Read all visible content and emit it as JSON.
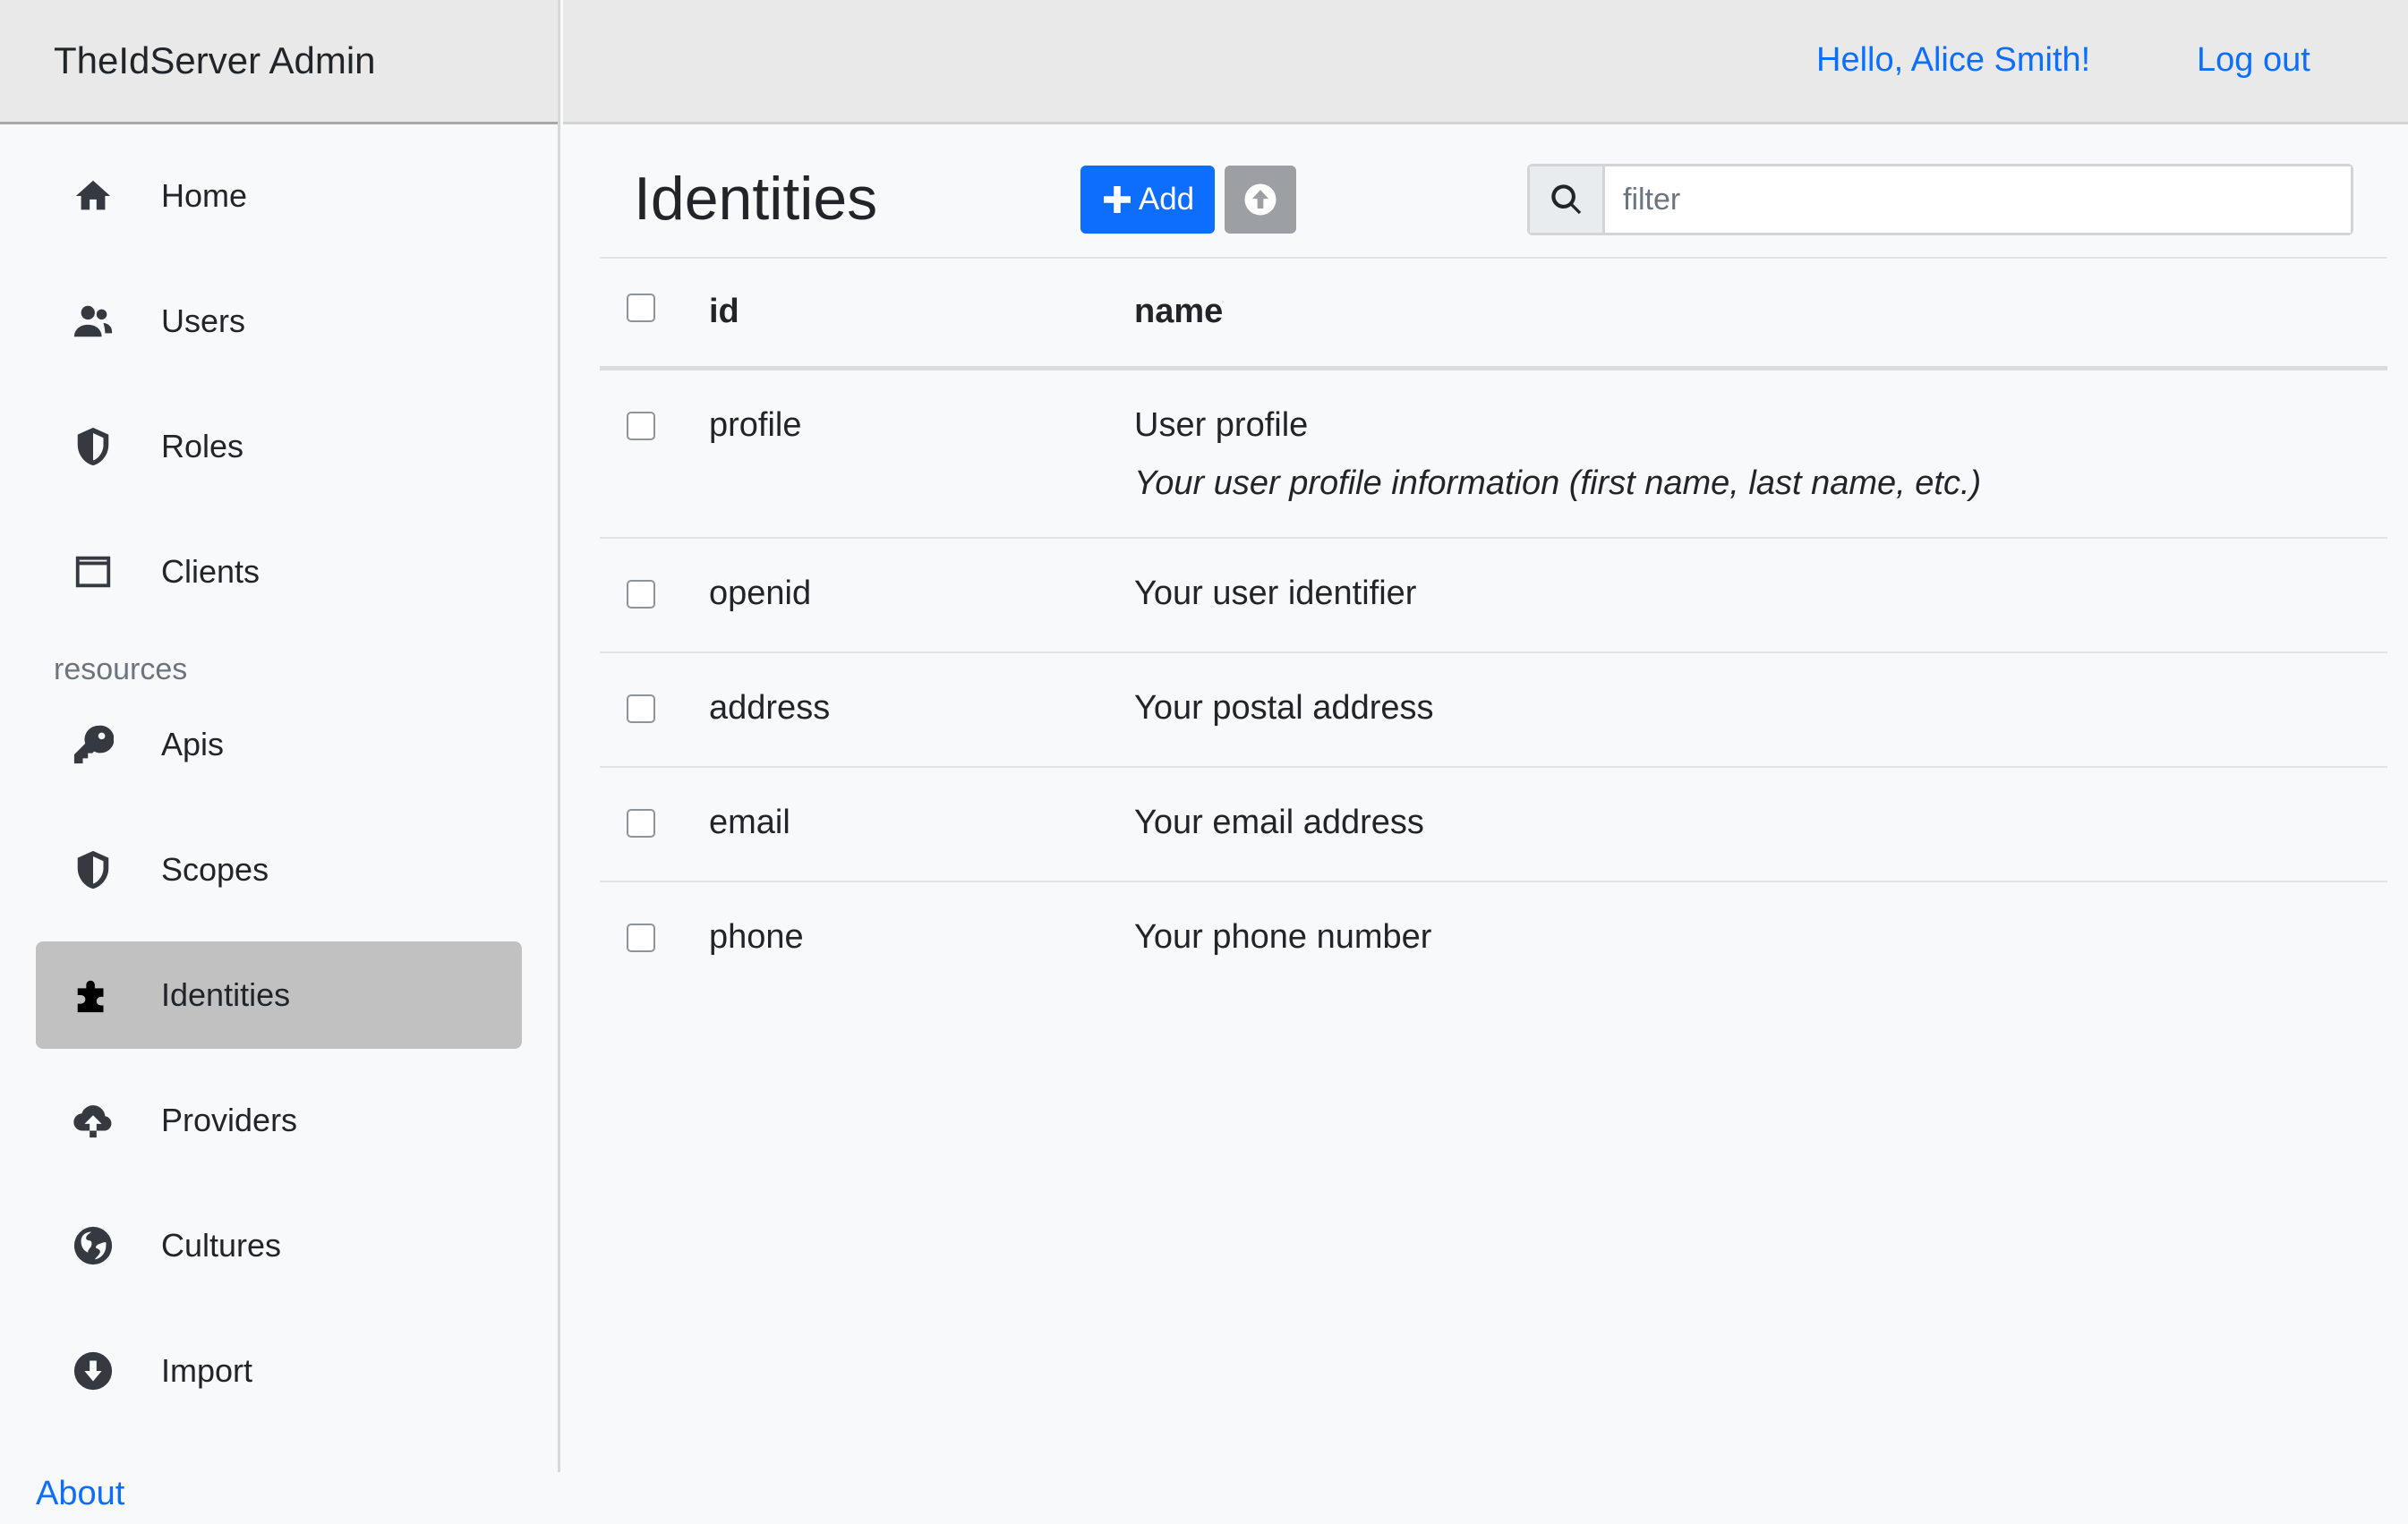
{
  "app": {
    "title": "TheIdServer Admin"
  },
  "header": {
    "greeting": "Hello, Alice Smith!",
    "logout": "Log out"
  },
  "sidebar": {
    "items": [
      {
        "label": "Home",
        "icon": "home-icon"
      },
      {
        "label": "Users",
        "icon": "users-icon"
      },
      {
        "label": "Roles",
        "icon": "shield-icon"
      },
      {
        "label": "Clients",
        "icon": "window-icon"
      }
    ],
    "section_label": "resources",
    "resource_items": [
      {
        "label": "Apis",
        "icon": "key-icon"
      },
      {
        "label": "Scopes",
        "icon": "shield-icon"
      },
      {
        "label": "Identities",
        "icon": "puzzle-icon",
        "active": true
      },
      {
        "label": "Providers",
        "icon": "cloud-upload-icon"
      },
      {
        "label": "Cultures",
        "icon": "globe-icon"
      },
      {
        "label": "Import",
        "icon": "download-icon"
      }
    ],
    "about": "About"
  },
  "main": {
    "title": "Identities",
    "add_label": "Add",
    "search_placeholder": "filter",
    "table": {
      "columns": [
        "id",
        "name"
      ],
      "rows": [
        {
          "id": "profile",
          "name": "User profile",
          "description": "Your user profile information (first name, last name, etc.)"
        },
        {
          "id": "openid",
          "name": "Your user identifier"
        },
        {
          "id": "address",
          "name": "Your postal address"
        },
        {
          "id": "email",
          "name": "Your email address"
        },
        {
          "id": "phone",
          "name": "Your phone number"
        }
      ]
    }
  },
  "colors": {
    "primary": "#0d6efd",
    "active_nav": "#c1c1c1",
    "secondary_button": "#9c9fa3"
  }
}
